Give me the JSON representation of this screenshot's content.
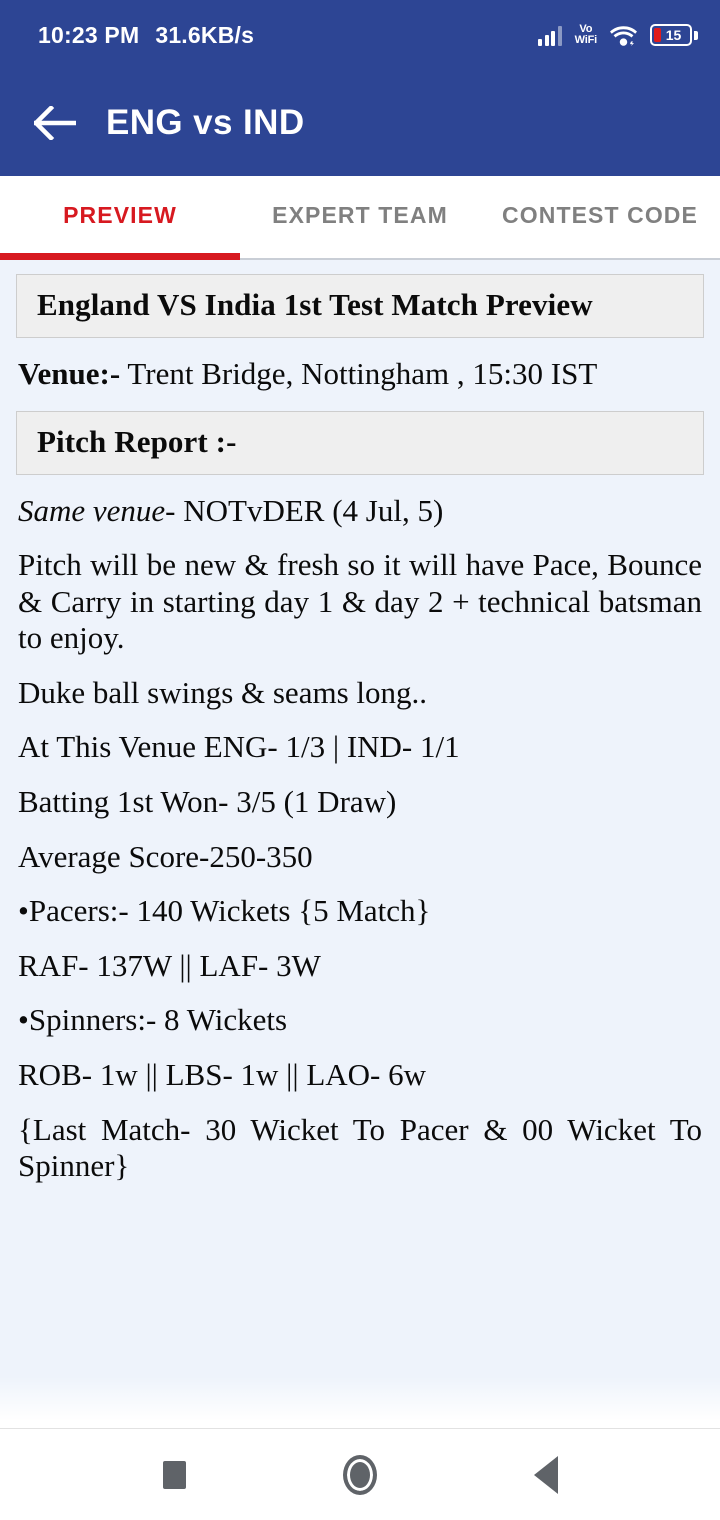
{
  "status_bar": {
    "time": "10:23 PM",
    "network_speed": "31.6KB/s",
    "vowifi_line1": "Vo",
    "vowifi_line2": "WiFi",
    "battery_level": "15",
    "accent_color": "#2d4594",
    "battery_fill_color": "#e01b1b"
  },
  "app_bar": {
    "title": "ENG vs IND",
    "background_color": "#2d4594"
  },
  "tabs": [
    {
      "label": "PREVIEW",
      "active": true
    },
    {
      "label": "EXPERT TEAM",
      "active": false
    },
    {
      "label": "CONTEST CODE",
      "active": false
    }
  ],
  "tab_colors": {
    "active": "#d71920",
    "inactive": "#808080"
  },
  "content": {
    "background_color": "#eef3fb",
    "preview_heading": "England VS India 1st Test Match Preview",
    "venue_label": "Venue:-",
    "venue_value": "Trent Bridge, Nottingham  , 15:30 IST",
    "pitch_report_heading": "Pitch Report :-",
    "same_venue_label": "Same venue-",
    "same_venue_value": "NOTvDER (4 Jul, 5)",
    "pitch_description": "Pitch will be new & fresh so it will have Pace, Bounce & Carry   in starting day 1 & day 2 + technical batsman to enjoy.",
    "duke_ball": "Duke ball swings & seams long..",
    "venue_record": "At This Venue ENG- 1/3 | IND- 1/1",
    "batting_first": "Batting 1st Won- 3/5 (1 Draw)",
    "average_score": "Average Score-250-350",
    "pacers": "•Pacers:- 140 Wickets   {5 Match}",
    "pacers_breakdown": "RAF- 137W     ||    LAF- 3W",
    "spinners": "•Spinners:-  8 Wickets",
    "spinners_breakdown": "ROB- 1w  ||  LBS- 1w   ||   LAO- 6w",
    "last_match": "{Last Match- 30 Wicket To Pacer & 00 Wicket To Spinner}"
  },
  "nav_bar": {
    "recents_label": "recents",
    "home_label": "home",
    "back_label": "back"
  }
}
